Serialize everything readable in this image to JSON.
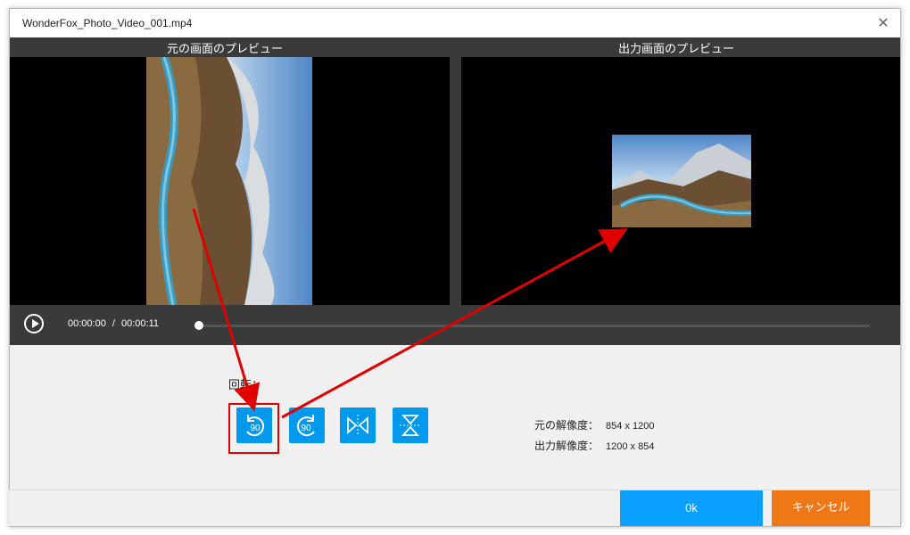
{
  "window": {
    "title": "WonderFox_Photo_Video_001.mp4",
    "close_glyph": "✕"
  },
  "preview": {
    "original_label": "元の画面のプレビュー",
    "output_label": "出力画面のプレビュー"
  },
  "player": {
    "current_time": "00:00:00",
    "separator": "/",
    "duration": "00:00:11",
    "progress": 0
  },
  "rotate": {
    "label": "回転：",
    "buttons": [
      {
        "icon": "rotate-left-90-icon",
        "text": "90"
      },
      {
        "icon": "rotate-right-90-icon",
        "text": "90"
      },
      {
        "icon": "flip-horizontal-icon"
      },
      {
        "icon": "flip-vertical-icon"
      }
    ],
    "selected": 0
  },
  "resolution": {
    "original_label": "元の解像度：",
    "original_value": "854 x 1200",
    "output_label": "出力解像度：",
    "output_value": "1200 x 854"
  },
  "footer": {
    "ok_label": "0k",
    "cancel_label": "キャンセル"
  },
  "colors": {
    "accent": "#0099ee",
    "cancel": "#f07716",
    "highlight": "#e10000",
    "arrow": "#e10000"
  }
}
